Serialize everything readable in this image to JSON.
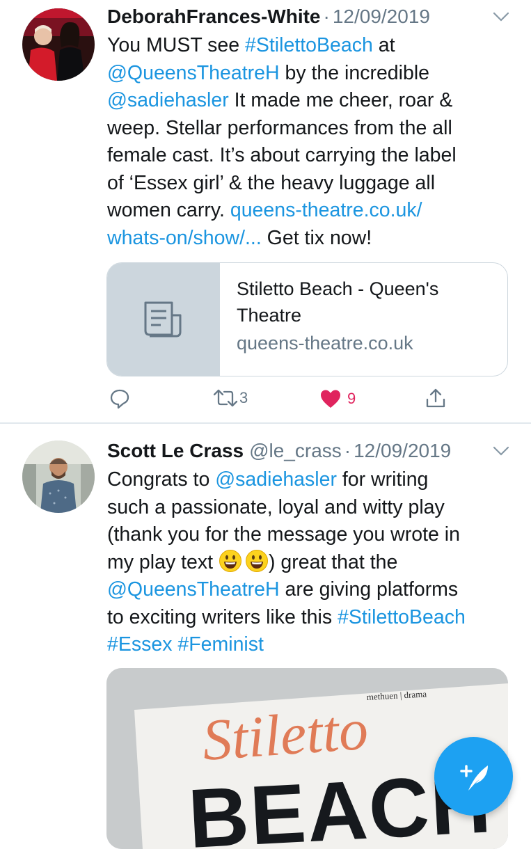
{
  "tweet1": {
    "name": "DeborahFrances-White",
    "separator": "·",
    "date": "12/09/2019",
    "lines": {
      "l1_a": "You MUST see ",
      "l1_b": "#StilettoBeach",
      "l1_c": " at",
      "l2_a": "@QueensTheatreH",
      "l2_b": " by the incredible",
      "l3_a": "@sadiehasler",
      "l3_b": " It made me cheer, roar &",
      "l4": "weep. Stellar performances from the all",
      "l5": "female cast. It’s about carrying the label",
      "l6": "of ‘Essex girl’ & the heavy luggage all",
      "l7_a": "women carry. ",
      "l7_b": "queens-theatre.co.uk/",
      "l8_a": "whats-on/show/...",
      "l8_b": " Get tix now!"
    },
    "card": {
      "title": "Stiletto Beach - Queen's Theatre",
      "domain": "queens-theatre.co.uk",
      "icon": "document-icon"
    },
    "actions": {
      "reply_count": "",
      "retweet_count": "3",
      "like_count": "9"
    }
  },
  "tweet2": {
    "name": "Scott Le Crass",
    "handle": "@le_crass",
    "separator": "·",
    "date": "12/09/2019",
    "lines": {
      "l1_a": "Congrats to ",
      "l1_b": "@sadiehasler",
      "l1_c": " for writing",
      "l2": "such a passionate, loyal and witty play",
      "l3": "(thank you for the message you wrote in",
      "l4_a": "my play text ",
      "l4_b": ") great that the",
      "l5_a": "@QueensTheatreH",
      "l5_b": " are giving platforms",
      "l6_a": "to exciting writers like this ",
      "l6_b": "#StilettoBeach",
      "l7_a": "#Essex",
      "l7_b": " ",
      "l7_c": "#Feminist"
    },
    "media": {
      "publisher": "methuen | drama",
      "title_script": "Stiletto",
      "title_block": "BEACH"
    }
  },
  "colors": {
    "link": "#1b95e0",
    "like": "#e0245e",
    "fab": "#1da1f2",
    "muted": "#657786"
  }
}
